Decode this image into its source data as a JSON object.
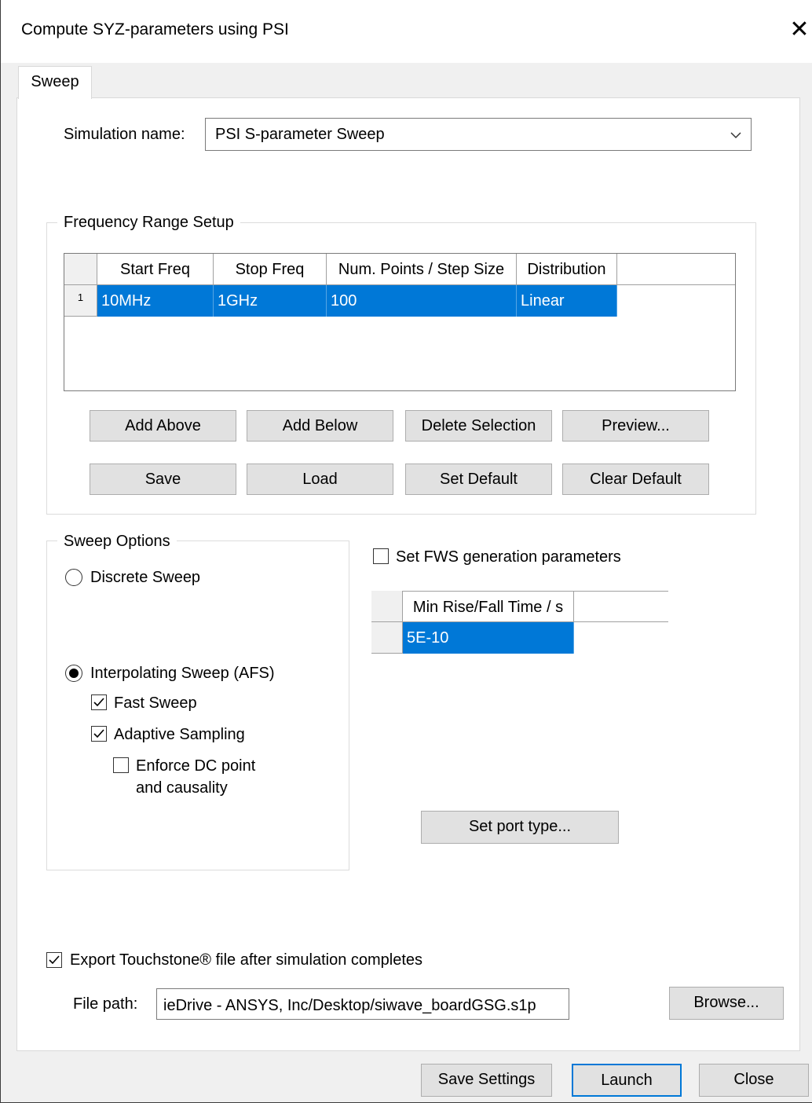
{
  "window": {
    "title": "Compute SYZ-parameters using PSI",
    "close_glyph": "✕"
  },
  "tabs": [
    {
      "label": "Sweep"
    }
  ],
  "simulation": {
    "label": "Simulation name:",
    "value": "PSI S-parameter Sweep"
  },
  "frequency_range": {
    "title": "Frequency Range Setup",
    "columns": [
      "Start Freq",
      "Stop Freq",
      "Num. Points / Step Size",
      "Distribution"
    ],
    "rows": [
      {
        "index": "1",
        "cells": [
          "10MHz",
          "1GHz",
          "100",
          "Linear"
        ]
      }
    ],
    "buttons": [
      "Add Above",
      "Add Below",
      "Delete Selection",
      "Preview...",
      "Save",
      "Load",
      "Set Default",
      "Clear Default"
    ]
  },
  "sweep_options": {
    "title": "Sweep Options",
    "discrete": {
      "label": "Discrete Sweep",
      "selected": false
    },
    "interpolating": {
      "label": "Interpolating Sweep (AFS)",
      "selected": true
    },
    "fast_sweep": {
      "label": "Fast Sweep",
      "checked": true
    },
    "adaptive_sampling": {
      "label": "Adaptive Sampling",
      "checked": true
    },
    "enforce_dc": {
      "label_line1": "Enforce DC point",
      "label_line2": "and causality",
      "checked": false
    }
  },
  "fws": {
    "label": "Set FWS generation parameters",
    "checked": false,
    "column": "Min Rise/Fall Time / s",
    "value": "5E-10"
  },
  "port_type_button": "Set port type...",
  "export": {
    "label": "Export Touchstone® file after simulation completes",
    "checked": true,
    "file_path_label": "File path:",
    "file_path_value": "ieDrive - ANSYS, Inc/Desktop/siwave_boardGSG.s1p",
    "browse_label": "Browse..."
  },
  "footer": {
    "save_settings": "Save Settings",
    "launch": "Launch",
    "close": "Close"
  },
  "colors": {
    "selection": "#0078d7",
    "button_face": "#e1e1e1",
    "panel": "#ffffff",
    "window": "#f0f0f0"
  }
}
